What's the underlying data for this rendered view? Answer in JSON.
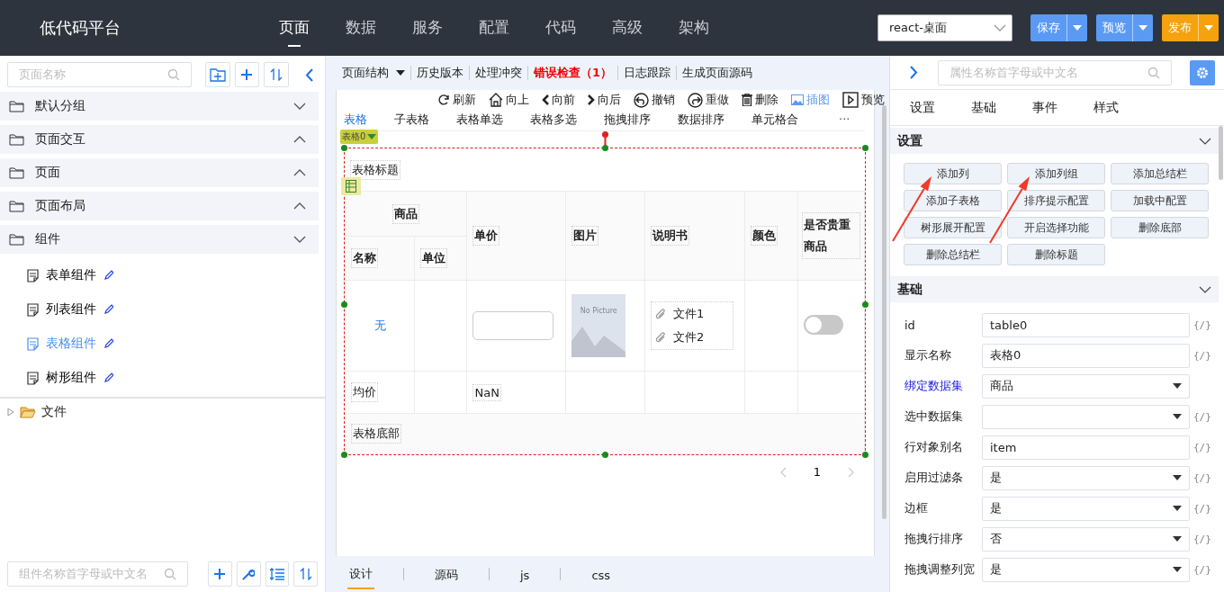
{
  "header": {
    "title": "低代码平台",
    "nav": [
      {
        "label": "页面",
        "selected": true
      },
      {
        "label": "数据",
        "selected": false
      },
      {
        "label": "服务",
        "selected": false
      },
      {
        "label": "配置",
        "selected": false
      },
      {
        "label": "代码",
        "selected": false
      },
      {
        "label": "高级",
        "selected": false
      },
      {
        "label": "架构",
        "selected": false
      }
    ],
    "platform": "react-桌面",
    "actions": [
      {
        "label": "保存",
        "kind": "primary"
      },
      {
        "label": "预览",
        "kind": "primary"
      },
      {
        "label": "发布",
        "kind": "warning"
      }
    ]
  },
  "page_panel": {
    "search": {
      "placeholder": "页面名称"
    },
    "groups": [
      {
        "label": "默认分组",
        "expanded": true
      },
      {
        "label": "页面交互",
        "expanded": false
      },
      {
        "label": "页面",
        "expanded": false
      },
      {
        "label": "页面布局",
        "expanded": false
      },
      {
        "label": "组件",
        "expanded": true,
        "children": [
          {
            "label": "表单组件",
            "selected": false
          },
          {
            "label": "列表组件",
            "selected": false
          },
          {
            "label": "表格组件",
            "selected": true
          },
          {
            "label": "树形组件",
            "selected": false
          }
        ]
      }
    ],
    "file_tree": [
      {
        "label": "文件",
        "expanded": false
      }
    ],
    "component_search": {
      "placeholder": "组件名称首字母或中文名"
    }
  },
  "designer": {
    "menu": [
      {
        "label": "页面结构",
        "kind": "dropdown"
      },
      {
        "label": "历史版本",
        "kind": "plain"
      },
      {
        "label": "处理冲突",
        "kind": "plain"
      },
      {
        "label": "错误检查（1）",
        "kind": "error"
      },
      {
        "label": "日志跟踪",
        "kind": "plain"
      },
      {
        "label": "生成页面源码",
        "kind": "plain"
      }
    ],
    "actions": [
      {
        "label": "刷新",
        "kind": "refresh",
        "highlighted": false
      },
      {
        "label": "向上",
        "kind": "up",
        "highlighted": false
      },
      {
        "label": "向前",
        "kind": "prev",
        "highlighted": false
      },
      {
        "label": "向后",
        "kind": "next",
        "highlighted": false
      },
      {
        "label": "撤销",
        "kind": "undo",
        "highlighted": false
      },
      {
        "label": "重做",
        "kind": "redo",
        "highlighted": false
      },
      {
        "label": "删除",
        "kind": "delete",
        "highlighted": false
      },
      {
        "label": "插图",
        "kind": "image",
        "highlighted": true
      },
      {
        "label": "预览",
        "kind": "preview",
        "highlighted": false
      }
    ],
    "component_tabs": [
      {
        "label": "表格",
        "selected": true
      },
      {
        "label": "子表格",
        "selected": false
      },
      {
        "label": "表格单选",
        "selected": false
      },
      {
        "label": "表格多选",
        "selected": false
      },
      {
        "label": "拖拽排序",
        "selected": false
      },
      {
        "label": "数据排序",
        "selected": false
      },
      {
        "label": "单元格合",
        "selected": false
      }
    ],
    "more": "···",
    "component_tag": "表格0",
    "table": {
      "caption": "表格标题",
      "group_header": "商品",
      "columns": [
        "名称",
        "单位",
        "单价",
        "图片",
        "说明书",
        "颜色",
        "是否贵重商品"
      ],
      "row": {
        "name": "无",
        "picture_label": "No Picture",
        "files": [
          "文件1",
          "文件2"
        ],
        "precious": false
      },
      "summary": {
        "label": "均价",
        "price": "NaN"
      },
      "footer": "表格底部"
    },
    "pagination": {
      "page": "1"
    },
    "view_tabs": [
      {
        "label": "设计",
        "selected": true
      },
      {
        "label": "源码",
        "selected": false
      },
      {
        "label": "js",
        "selected": false
      },
      {
        "label": "css",
        "selected": false
      }
    ]
  },
  "properties": {
    "search": {
      "placeholder": "属性名称首字母或中文名"
    },
    "tabs": [
      "设置",
      "基础",
      "事件",
      "样式"
    ],
    "settings": {
      "title": "设置",
      "expanded": true,
      "buttons": [
        "添加列",
        "添加列组",
        "添加总结栏",
        "添加子表格",
        "排序提示配置",
        "加载中配置",
        "树形展开配置",
        "开启选择功能",
        "删除底部",
        "删除总结栏",
        "删除标题"
      ]
    },
    "basic": {
      "title": "基础",
      "expanded": true,
      "fields": [
        {
          "label": "id",
          "kind": "input",
          "value": "table0",
          "bound": false,
          "expression": "{/}"
        },
        {
          "label": "显示名称",
          "kind": "input",
          "value": "表格0",
          "bound": false,
          "expression": "{/}"
        },
        {
          "label": "绑定数据集",
          "kind": "select",
          "value": "商品",
          "bound": true
        },
        {
          "label": "选中数据集",
          "kind": "select",
          "bound": false,
          "expression": "{/}"
        },
        {
          "label": "行对象别名",
          "kind": "input",
          "value": "item",
          "bound": false,
          "expression": "{/}"
        },
        {
          "label": "启用过滤条",
          "kind": "select",
          "value": "是",
          "bound": false,
          "expression": "{/}"
        },
        {
          "label": "边框",
          "kind": "select",
          "value": "是",
          "bound": false,
          "expression": "{/}"
        },
        {
          "label": "拖拽行排序",
          "kind": "select",
          "value": "否",
          "bound": false,
          "expression": "{/}"
        },
        {
          "label": "拖拽调整列宽",
          "kind": "select",
          "value": "是",
          "bound": false,
          "expression": "{/}"
        }
      ]
    }
  }
}
